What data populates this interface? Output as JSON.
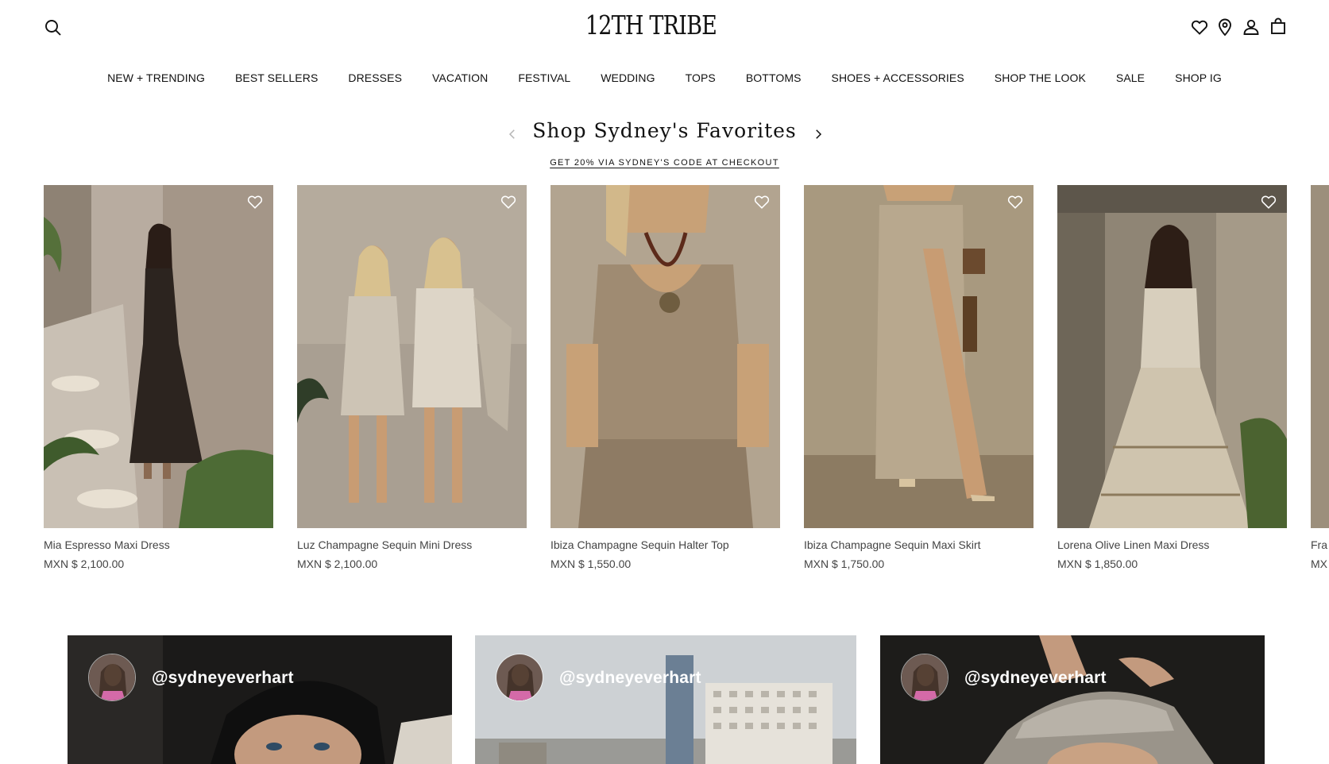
{
  "header": {
    "logo": "12TH TRIBE",
    "icons": [
      "search-icon",
      "heart-icon",
      "location-pin-icon",
      "account-icon",
      "bag-icon"
    ]
  },
  "nav": [
    {
      "label": "NEW + TRENDING"
    },
    {
      "label": "BEST SELLERS"
    },
    {
      "label": "DRESSES"
    },
    {
      "label": "VACATION"
    },
    {
      "label": "FESTIVAL"
    },
    {
      "label": "WEDDING"
    },
    {
      "label": "TOPS"
    },
    {
      "label": "BOTTOMS"
    },
    {
      "label": "SHOES + ACCESSORIES"
    },
    {
      "label": "SHOP THE LOOK"
    },
    {
      "label": "SALE"
    },
    {
      "label": "SHOP IG"
    }
  ],
  "section": {
    "title": "Shop Sydney's Favorites",
    "subtitle": "GET 20% VIA SYDNEY'S CODE AT CHECKOUT"
  },
  "products": [
    {
      "name": "Mia Espresso Maxi Dress",
      "price": "MXN $ 2,100.00"
    },
    {
      "name": "Luz Champagne Sequin Mini Dress",
      "price": "MXN $ 2,100.00"
    },
    {
      "name": "Ibiza Champagne Sequin Halter Top",
      "price": "MXN $ 1,550.00"
    },
    {
      "name": "Ibiza Champagne Sequin Maxi Skirt",
      "price": "MXN $ 1,750.00"
    },
    {
      "name": "Lorena Olive Linen Maxi Dress",
      "price": "MXN $ 1,850.00"
    },
    {
      "name": "Fra",
      "price": "MX"
    }
  ],
  "instagram": [
    {
      "handle": "@sydneyeverhart"
    },
    {
      "handle": "@sydneyeverhart"
    },
    {
      "handle": "@sydneyeverhart"
    }
  ],
  "colors": {
    "text": "#111111",
    "muted": "#444444",
    "arrow_disabled": "#b5b5b5"
  }
}
